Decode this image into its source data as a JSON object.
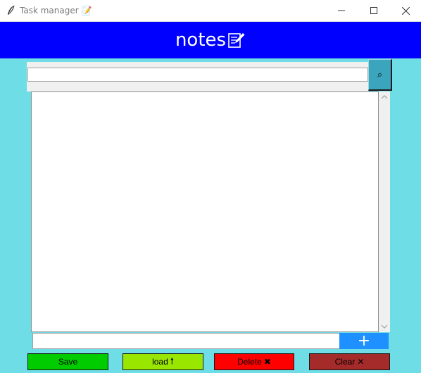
{
  "window": {
    "title": "Task manager 📝"
  },
  "header": {
    "title": "notes",
    "title_icon": "memo-icon",
    "background": "#0000ff"
  },
  "search": {
    "value": "",
    "placeholder": "",
    "button_icon": "search-icon",
    "button_glyph": "⌕"
  },
  "notes": {
    "content": ""
  },
  "add_task": {
    "value": "",
    "placeholder": "",
    "button_glyph": "+"
  },
  "actions": {
    "save_label": "Save",
    "load_label": "load",
    "load_glyph": "🠕",
    "delete_label": "Delete",
    "delete_glyph": "✖",
    "clear_label": "Clear",
    "clear_glyph": "✕"
  },
  "colors": {
    "background": "#6fdde6",
    "search_button": "#3aa5bd",
    "add_button": "#1e90ff",
    "save": "#00cc00",
    "load": "#99e600",
    "delete": "#ff0000",
    "clear": "#a52a2a"
  }
}
